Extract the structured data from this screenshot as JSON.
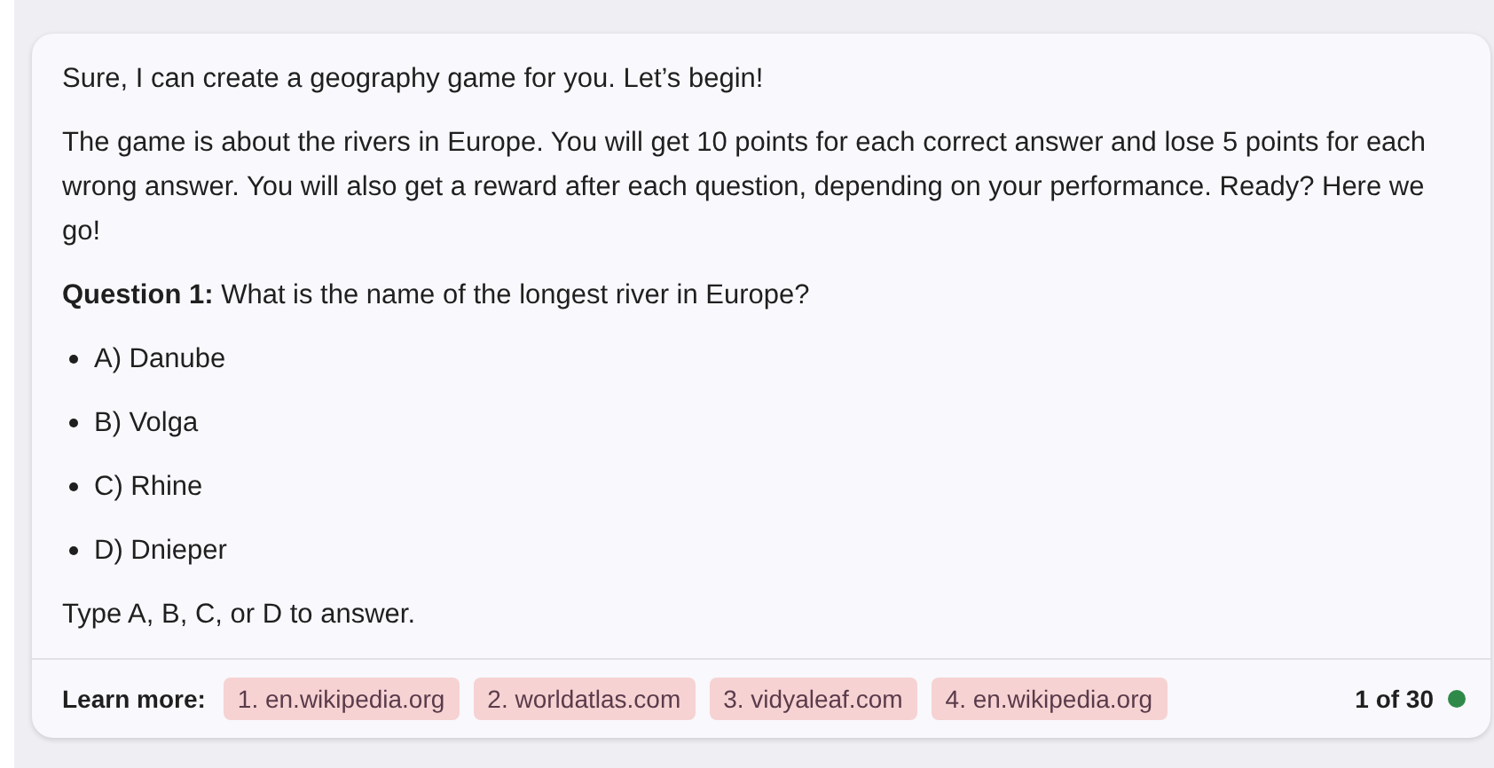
{
  "message": {
    "paragraphs": [
      "Sure, I can create a geography game for you. Let’s begin!",
      "The game is about the rivers in Europe. You will get 10 points for each correct answer and lose 5 points for each wrong answer. You will also get a reward after each question, depending on your performance. Ready? Here we go!",
      "**Question 1:** What is the name of the longest river in Europe?"
    ],
    "options": [
      "A) Danube",
      "B) Volga",
      "C) Rhine",
      "D) Dnieper"
    ],
    "closing": "Type A, B, C, or D to answer."
  },
  "footer": {
    "label": "Learn more:",
    "sources": [
      "1. en.wikipedia.org",
      "2. worldatlas.com",
      "3. vidyaleaf.com",
      "4. en.wikipedia.org"
    ],
    "counter": "1 of 30"
  }
}
